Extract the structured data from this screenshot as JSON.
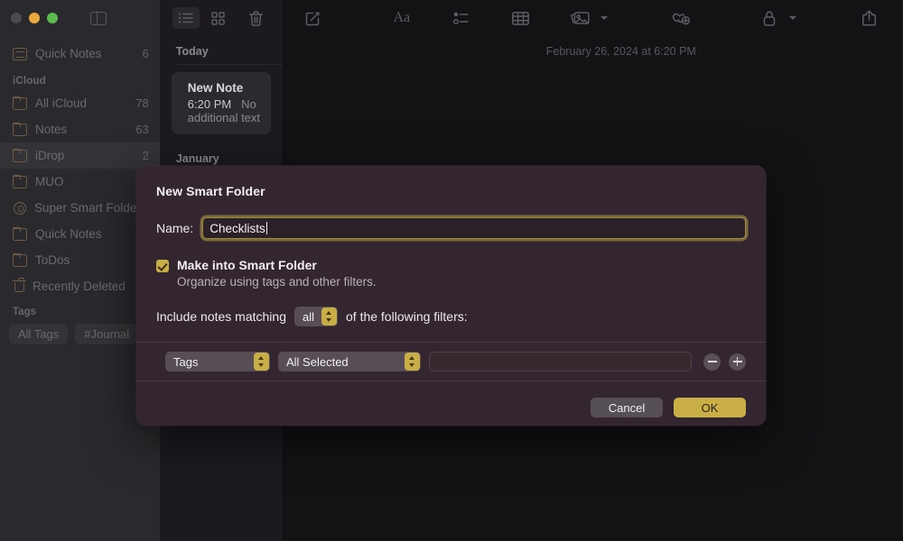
{
  "window": {
    "traffic_lights": [
      "close",
      "minimize",
      "maximize"
    ],
    "sidebar_toggle_icon": "sidebar-toggle-icon"
  },
  "sidebar": {
    "top_items": [
      {
        "label": "Quick Notes",
        "count": "6",
        "icon": "quick-note-icon"
      }
    ],
    "sections": [
      {
        "title": "iCloud",
        "items": [
          {
            "label": "All iCloud",
            "count": "78",
            "icon": "folder-icon",
            "selected": false
          },
          {
            "label": "Notes",
            "count": "63",
            "icon": "folder-icon",
            "selected": false
          },
          {
            "label": "iDrop",
            "count": "2",
            "icon": "folder-icon",
            "selected": true
          },
          {
            "label": "MUO",
            "count": "",
            "icon": "folder-icon",
            "selected": false
          },
          {
            "label": "Super Smart Folder",
            "count": "",
            "icon": "gear-icon",
            "selected": false
          },
          {
            "label": "Quick Notes",
            "count": "",
            "icon": "folder-icon",
            "selected": false
          },
          {
            "label": "ToDos",
            "count": "",
            "icon": "folder-icon",
            "selected": false
          },
          {
            "label": "Recently Deleted",
            "count": "",
            "icon": "trash-icon",
            "selected": false
          }
        ]
      }
    ],
    "tags": {
      "title": "Tags",
      "pills": [
        "All Tags",
        "#Journal"
      ]
    }
  },
  "notelist": {
    "toolbar": {
      "list_view_icon": "list-view-icon",
      "grid_view_icon": "grid-view-icon",
      "delete_icon": "trash-icon"
    },
    "groups": [
      {
        "title": "Today",
        "notes": [
          {
            "title": "New Note",
            "time": "6:20 PM",
            "preview": "No additional text"
          }
        ]
      },
      {
        "title": "January",
        "notes": []
      }
    ]
  },
  "editor": {
    "toolbar_icons": [
      "compose-icon",
      "format-text-icon",
      "checklist-icon",
      "table-icon",
      "media-icon",
      "media-chevron-icon",
      "collaborate-icon",
      "lock-icon",
      "lock-chevron-icon",
      "share-icon",
      "search-icon"
    ],
    "format_label": "Aa",
    "date": "February 26, 2024 at 6:20 PM"
  },
  "dialog": {
    "title": "New Smart Folder",
    "name_label": "Name:",
    "name_value": "Checklists",
    "name_placeholder": "",
    "smart_folder_checkbox": {
      "checked": true,
      "label": "Make into Smart Folder",
      "sublabel": "Organize using tags and other filters."
    },
    "match_prefix": "Include notes matching",
    "match_value": "all",
    "match_suffix": "of the following filters:",
    "filter_row": {
      "attribute": "Tags",
      "operator": "All Selected",
      "value": "",
      "remove_label": "−",
      "add_label": "+"
    },
    "buttons": {
      "cancel": "Cancel",
      "ok": "OK"
    },
    "colors": {
      "background": "#332630",
      "accent": "#c9ad45",
      "focus_ring": "#9c8a3f"
    }
  }
}
